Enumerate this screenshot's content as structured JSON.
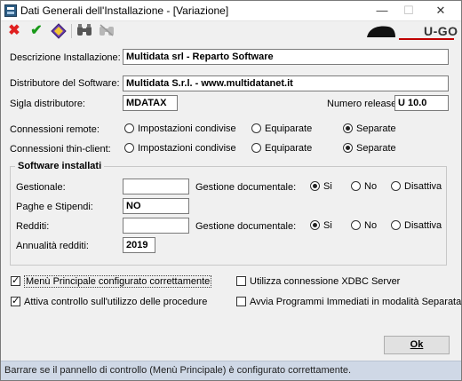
{
  "window": {
    "title": "Dati Generali dell'Installazione - [Variazione]",
    "minimize": "—",
    "maximize": "☐",
    "close": "✕"
  },
  "toolbar": {
    "icons": [
      "cancel-icon",
      "confirm-icon",
      "key-icon",
      "binoculars-icon",
      "binoculars-disabled-icon"
    ]
  },
  "logo": {
    "text": "U-GO"
  },
  "form": {
    "descrizione_label": "Descrizione Installazione:",
    "descrizione_value": "Multidata srl - Reparto Software",
    "distributore_label": "Distributore del Software:",
    "distributore_value": "Multidata S.r.l. - www.multidatanet.it",
    "sigla_label": "Sigla distributore:",
    "sigla_value": "MDATAX",
    "release_label": "Numero release:",
    "release_value": "U 10.0",
    "connessioni_remote_label": "Connessioni remote:",
    "connessioni_thin_label": "Connessioni thin-client:",
    "opt_condivise": "Impostazioni condivise",
    "opt_equiparate": "Equiparate",
    "opt_separate": "Separate"
  },
  "software": {
    "group_title": "Software installati",
    "gestionale_label": "Gestionale:",
    "gestionale_value": "",
    "gestione_doc_label": "Gestione documentale:",
    "paghe_label": "Paghe e Stipendi:",
    "paghe_value": "NO",
    "redditi_label": "Redditi:",
    "redditi_value": "",
    "annualita_label": "Annualità redditi:",
    "annualita_value": "2019",
    "opt_si": "Si",
    "opt_no": "No",
    "opt_disattiva": "Disattiva"
  },
  "checks": {
    "menu_principale": "Menù Principale configurato correttamente",
    "attiva_controllo": "Attiva controllo sull'utilizzo delle procedure",
    "xdbc": "Utilizza connessione XDBC Server",
    "avvia_programmi": "Avvia Programmi Immediati in modalità Separata"
  },
  "buttons": {
    "ok": "Ok"
  },
  "status": {
    "text": "Barrare se il pannello di controllo (Menù Principale) è configurato correttamente."
  }
}
